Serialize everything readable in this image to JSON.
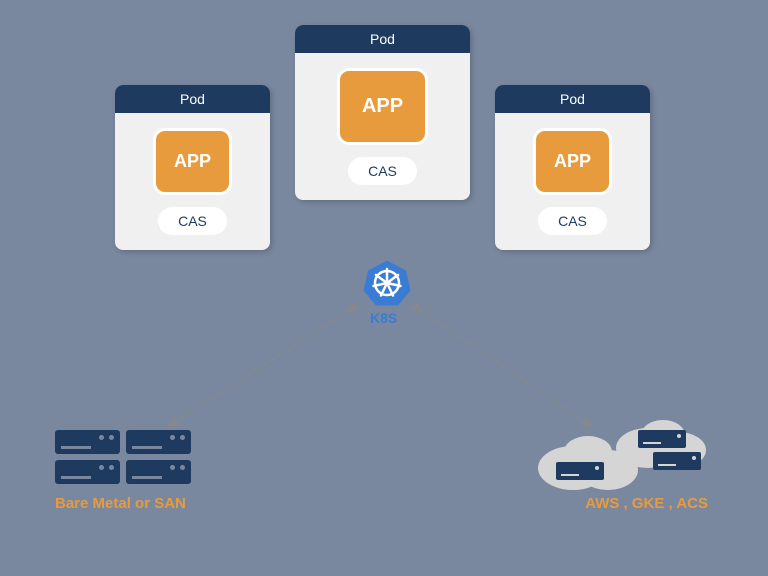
{
  "pods": [
    {
      "title": "Pod",
      "app": "APP",
      "cas": "CAS"
    },
    {
      "title": "Pod",
      "app": "APP",
      "cas": "CAS"
    },
    {
      "title": "Pod",
      "app": "APP",
      "cas": "CAS"
    }
  ],
  "center": {
    "label": "K8S"
  },
  "left_infra": {
    "label": "Bare Metal or SAN"
  },
  "right_infra": {
    "label": "AWS ,  GKE ,  ACS"
  }
}
